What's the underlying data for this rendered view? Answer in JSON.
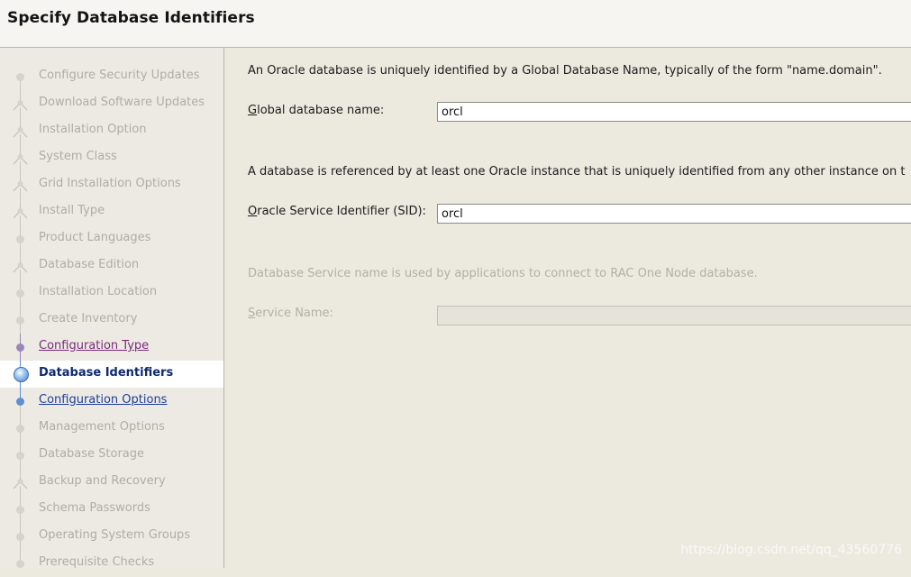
{
  "header": {
    "title": "Specify Database Identifiers"
  },
  "sidebar": {
    "steps": [
      {
        "label": "Configure Security Updates",
        "state": "pending",
        "fork": false
      },
      {
        "label": "Download Software Updates",
        "state": "pending",
        "fork": true
      },
      {
        "label": "Installation Option",
        "state": "pending",
        "fork": true
      },
      {
        "label": "System Class",
        "state": "pending",
        "fork": true
      },
      {
        "label": "Grid Installation Options",
        "state": "pending",
        "fork": true
      },
      {
        "label": "Install Type",
        "state": "pending",
        "fork": true
      },
      {
        "label": "Product Languages",
        "state": "pending",
        "fork": false
      },
      {
        "label": "Database Edition",
        "state": "pending",
        "fork": true
      },
      {
        "label": "Installation Location",
        "state": "pending",
        "fork": false
      },
      {
        "label": "Create Inventory",
        "state": "pending",
        "fork": false
      },
      {
        "label": "Configuration Type",
        "state": "visited",
        "fork": false
      },
      {
        "label": "Database Identifiers",
        "state": "current",
        "fork": false
      },
      {
        "label": "Configuration Options",
        "state": "link",
        "fork": false
      },
      {
        "label": "Management Options",
        "state": "pending",
        "fork": false
      },
      {
        "label": "Database Storage",
        "state": "pending",
        "fork": false
      },
      {
        "label": "Backup and Recovery",
        "state": "pending",
        "fork": true
      },
      {
        "label": "Schema Passwords",
        "state": "pending",
        "fork": false
      },
      {
        "label": "Operating System Groups",
        "state": "pending",
        "fork": false
      },
      {
        "label": "Prerequisite Checks",
        "state": "pending",
        "fork": false
      }
    ]
  },
  "main": {
    "intro_text": "An Oracle database is uniquely identified by a Global Database Name, typically of the form \"name.domain\".",
    "global_db_label_first": "G",
    "global_db_label_rest": "lobal database name:",
    "global_db_value": "orcl",
    "instance_text": "A database is referenced by at least one Oracle instance that is uniquely identified from any other instance on t",
    "sid_label_first": "O",
    "sid_label_rest": "racle Service Identifier (SID):",
    "sid_value": "orcl",
    "service_text": "Database Service name is used by applications to connect to RAC One Node database.",
    "service_label_first": "S",
    "service_label_rest": "ervice Name:",
    "service_value": ""
  },
  "watermark": "https://blog.csdn.net/qq_43560776",
  "colors": {
    "visited": "#7a2c7a",
    "link": "#1f3f9c",
    "current": "#0e2a6e",
    "disabled_text": "#b0ada4"
  }
}
